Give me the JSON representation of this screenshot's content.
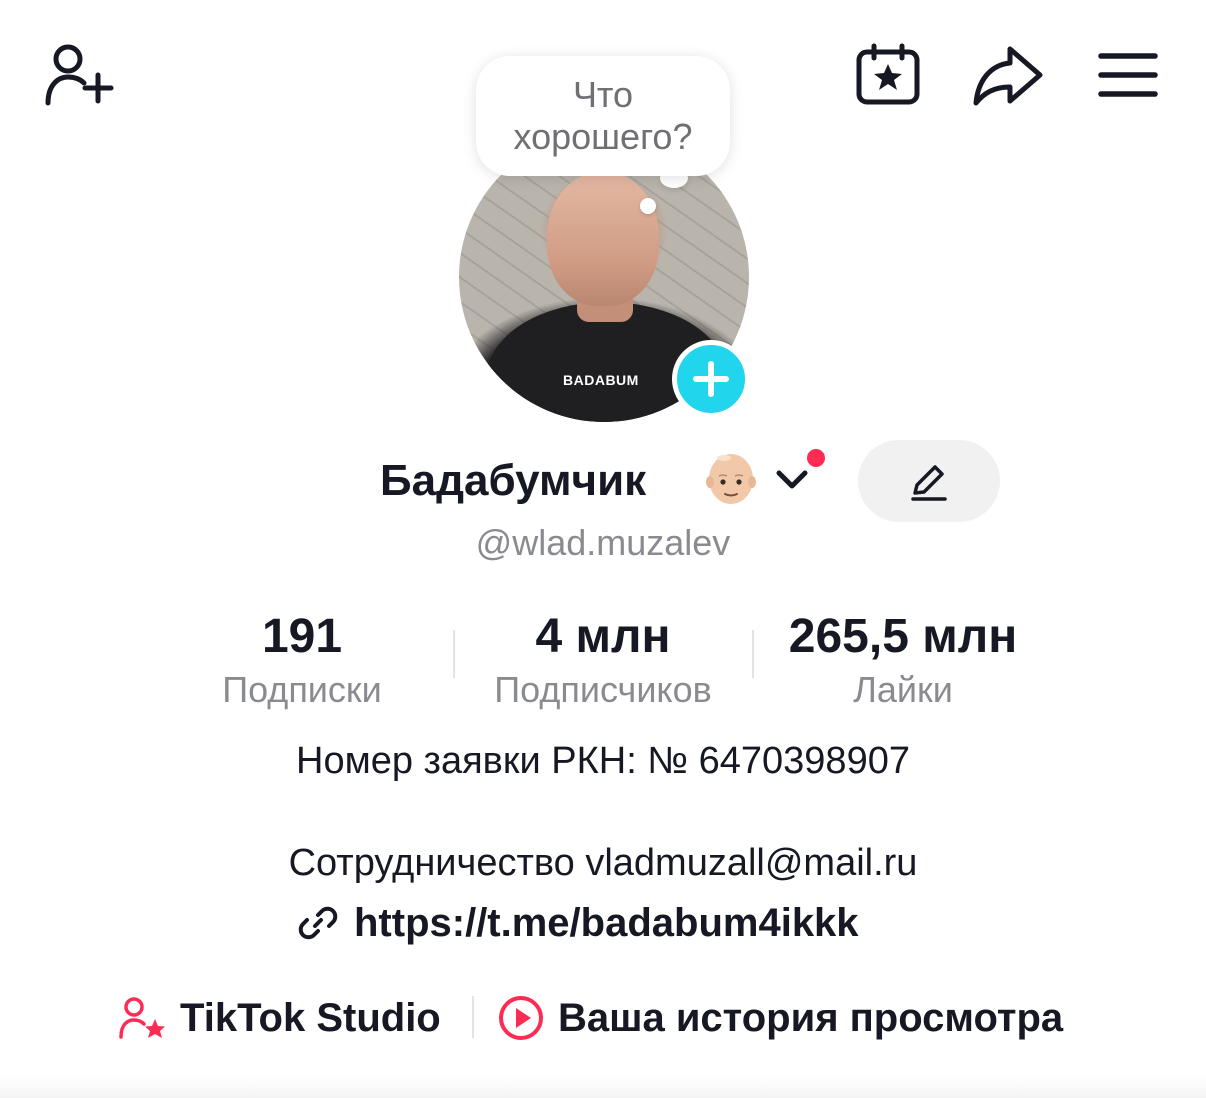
{
  "top_bar": {
    "add_friend_icon": "person-plus-icon",
    "calendar_icon": "calendar-star-icon",
    "share_icon": "share-arrow-icon",
    "menu_icon": "hamburger-menu-icon"
  },
  "profile": {
    "thought_bubble": "Что хорошего?",
    "display_name": "Бадабумчик",
    "emoji": "bald-person-emoji",
    "username": "@wlad.muzalev",
    "shirt_text": "BADABUM"
  },
  "stats": [
    {
      "value": "191",
      "label": "Подписки"
    },
    {
      "value": "4 млн",
      "label": "Подписчиков"
    },
    {
      "value": "265,5 млн",
      "label": "Лайки"
    }
  ],
  "bio": {
    "line1": "Номер заявки РКН: № 6470398907",
    "line2": "Сотрудничество vladmuzall@mail.ru",
    "link": "https://t.me/badabum4ikkk"
  },
  "shortcuts": {
    "studio": "TikTok Studio",
    "history": "Ваша история просмотра"
  },
  "colors": {
    "accent_cyan": "#20d5ec",
    "accent_red": "#fe2c55",
    "text_primary": "#161823",
    "text_secondary": "#8a8b91"
  }
}
